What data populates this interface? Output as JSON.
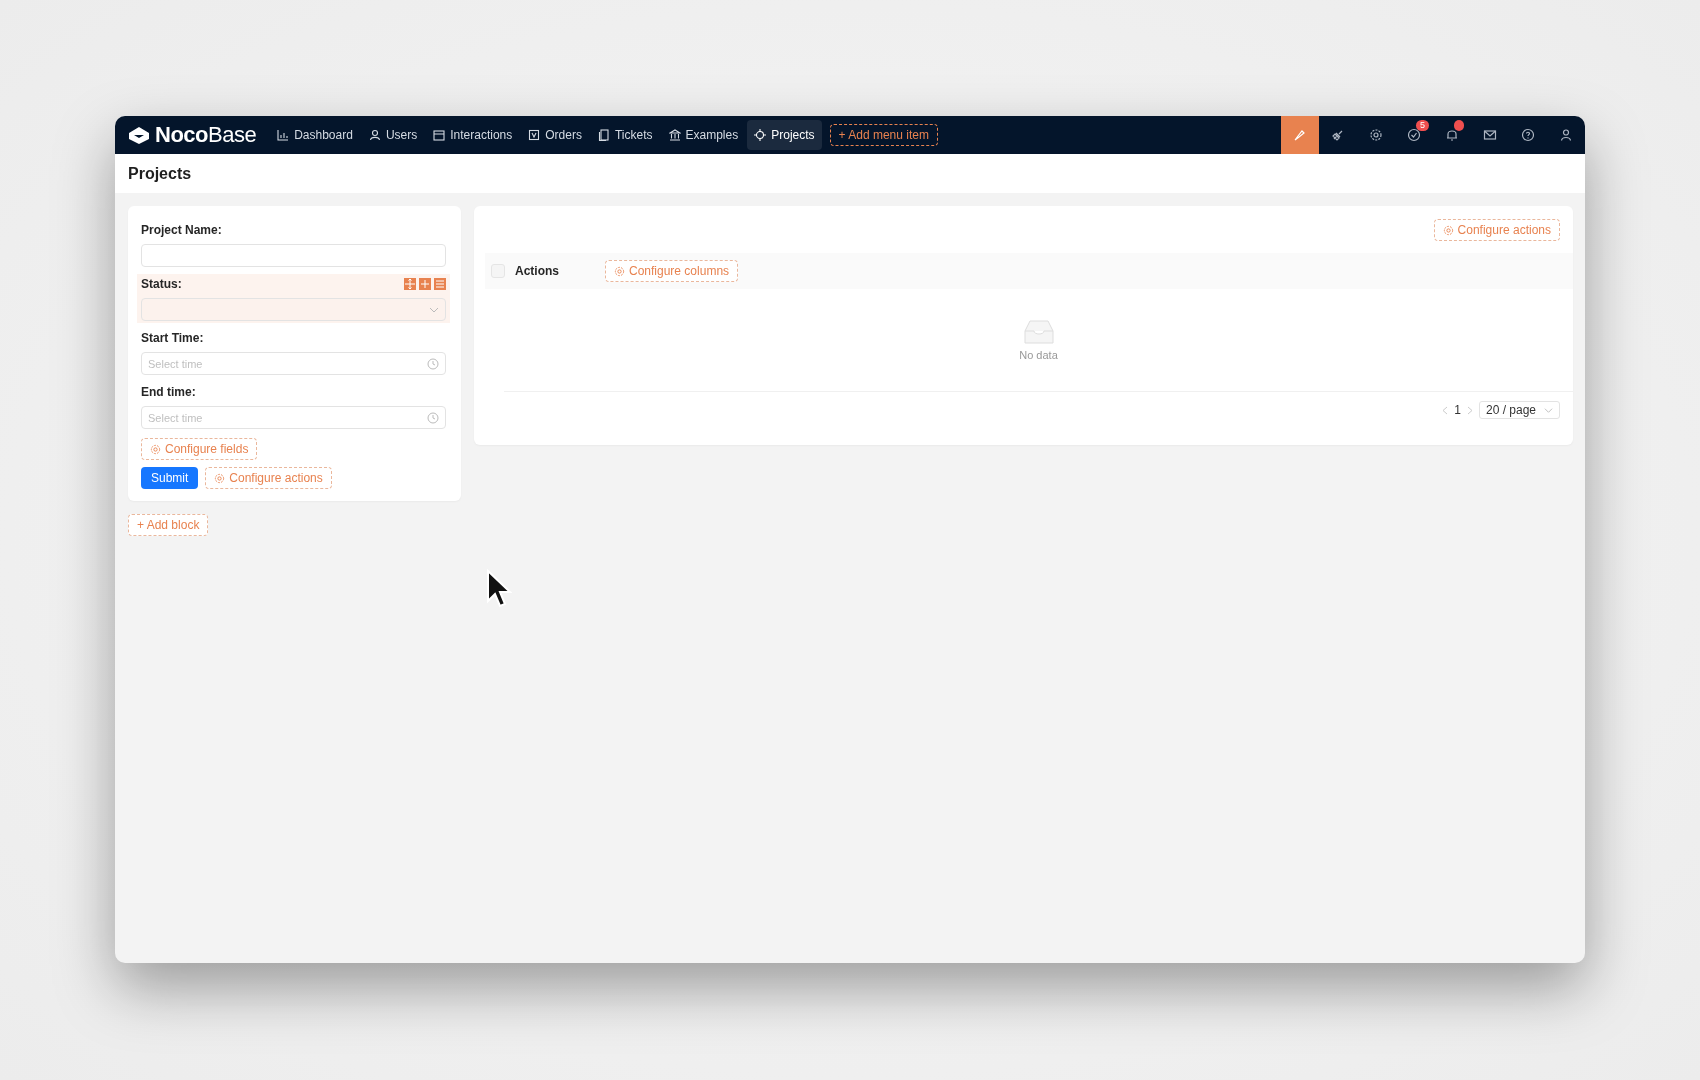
{
  "logo": "**Noco**Base",
  "nav": [
    {
      "label": "Dashboard",
      "selected": false
    },
    {
      "label": "Users",
      "selected": false
    },
    {
      "label": "Interactions",
      "selected": false
    },
    {
      "label": "Orders",
      "selected": false
    },
    {
      "label": "Tickets",
      "selected": false
    },
    {
      "label": "Examples",
      "selected": false
    },
    {
      "label": "Projects",
      "selected": true
    }
  ],
  "add_menu_item": "+ Add menu item",
  "toolbar": [
    {
      "kind": "brush",
      "selected": true
    },
    {
      "kind": "plugin",
      "selected": false
    },
    {
      "kind": "settings",
      "selected": false
    },
    {
      "kind": "tasks",
      "selected": false,
      "badge": "5"
    },
    {
      "kind": "bell",
      "selected": false,
      "alert": true
    },
    {
      "kind": "mail",
      "selected": false
    },
    {
      "kind": "help",
      "selected": false
    },
    {
      "kind": "user",
      "selected": false
    }
  ],
  "page_title": "Projects",
  "form": {
    "fields": [
      {
        "label": "Project Name:",
        "kind": "text",
        "hovered": false
      },
      {
        "label": "Status:",
        "kind": "select",
        "hovered": true
      },
      {
        "label": "Start Time:",
        "kind": "time",
        "hovered": false,
        "placeholder": "Select time"
      },
      {
        "label": "End time:",
        "kind": "time",
        "hovered": false,
        "placeholder": "Select time"
      }
    ],
    "configure_fields": "Configure fields",
    "submit": "Submit",
    "configure_actions": "Configure actions"
  },
  "add_block": "+ Add block",
  "table": {
    "select_all_checked": false,
    "configure_actions": "Configure actions",
    "column_header": "Actions",
    "configure_columns": "Configure columns",
    "empty_text": "No data",
    "page": "1",
    "page_size": "20 / page"
  }
}
